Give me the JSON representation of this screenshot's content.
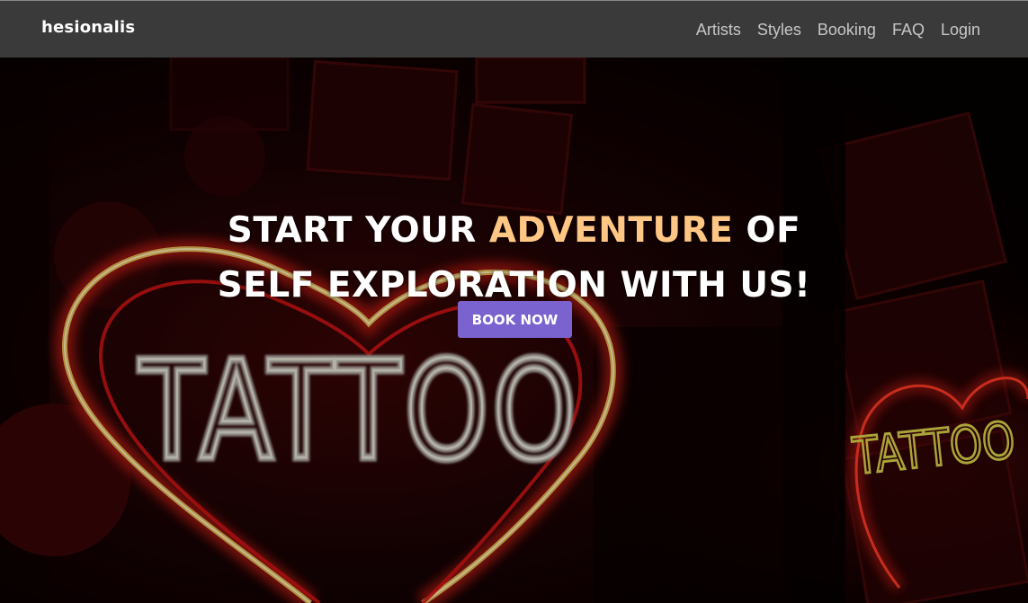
{
  "nav": {
    "brand": "hesionalis",
    "links": [
      "Artists",
      "Styles",
      "Booking",
      "FAQ",
      "Login"
    ]
  },
  "hero": {
    "headline_part1": "START YOUR ",
    "headline_accent": "ADVENTURE",
    "headline_part2": " OF",
    "headline_line2": "SELF EXPLORATION WITH US!",
    "cta_label": "BOOK NOW",
    "background_sign_large": "TATTOO",
    "background_sign_small": "TATTOO"
  },
  "colors": {
    "navbar": "#3a3a3a",
    "accent_text": "#ffc684",
    "cta_button": "#7a63cf"
  }
}
